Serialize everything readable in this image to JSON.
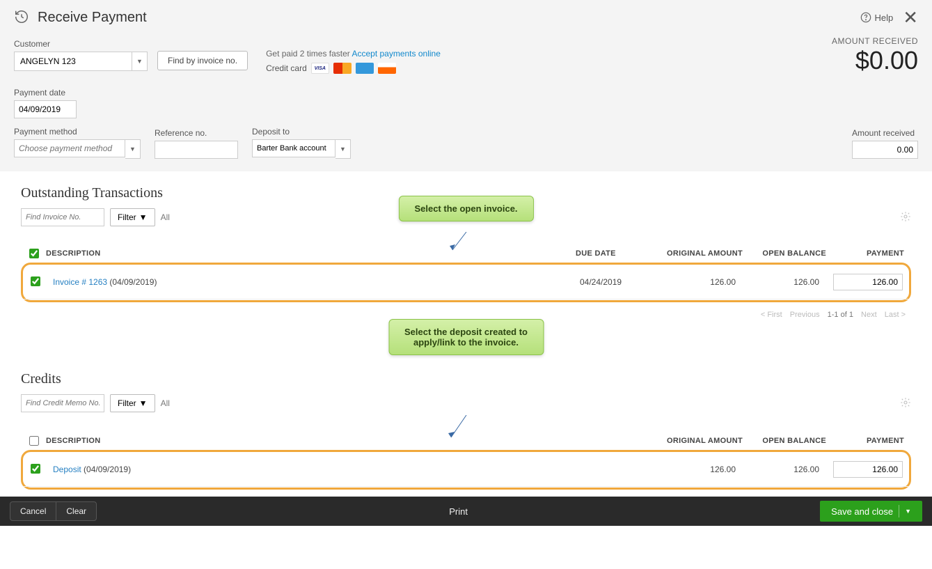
{
  "header": {
    "title": "Receive Payment",
    "help": "Help"
  },
  "customer": {
    "label": "Customer",
    "value": "ANGELYN 123",
    "find_btn": "Find by invoice no."
  },
  "promo": {
    "text": "Get paid 2 times faster",
    "link": "Accept payments online",
    "cc_label": "Credit card",
    "visa": "VISA",
    "mc": "",
    "amex": "",
    "disc": ""
  },
  "amount_received": {
    "label": "AMOUNT RECEIVED",
    "value": "$0.00"
  },
  "payment_date": {
    "label": "Payment date",
    "value": "04/09/2019"
  },
  "payment_method": {
    "label": "Payment method",
    "placeholder": "Choose payment method"
  },
  "reference": {
    "label": "Reference no.",
    "value": ""
  },
  "deposit_to": {
    "label": "Deposit to",
    "value": "Barter Bank account"
  },
  "amt_rec_field": {
    "label": "Amount received",
    "value": "0.00"
  },
  "outstanding": {
    "title": "Outstanding Transactions",
    "find_placeholder": "Find Invoice No.",
    "filter": "Filter",
    "all": "All",
    "cols": {
      "desc": "DESCRIPTION",
      "due": "DUE DATE",
      "orig": "ORIGINAL AMOUNT",
      "open": "OPEN BALANCE",
      "pay": "PAYMENT"
    },
    "row": {
      "link": "Invoice # 1263",
      "date": "(04/09/2019)",
      "due": "04/24/2019",
      "orig": "126.00",
      "open": "126.00",
      "pay": "126.00"
    }
  },
  "credits": {
    "title": "Credits",
    "find_placeholder": "Find Credit Memo No.",
    "filter": "Filter",
    "all": "All",
    "cols": {
      "desc": "DESCRIPTION",
      "orig": "ORIGINAL AMOUNT",
      "open": "OPEN BALANCE",
      "pay": "PAYMENT"
    },
    "row": {
      "link": "Deposit",
      "date": "(04/09/2019)",
      "orig": "126.00",
      "open": "126.00",
      "pay": "126.00"
    }
  },
  "pager": {
    "first": "< First",
    "prev": "Previous",
    "count": "1-1 of 1",
    "next": "Next",
    "last": "Last >"
  },
  "callouts": {
    "c1": "Select the open invoice.",
    "c2_l1": "Select the deposit created to",
    "c2_l2": "apply/link to the invoice."
  },
  "footer": {
    "cancel": "Cancel",
    "clear": "Clear",
    "print": "Print",
    "save": "Save and close"
  }
}
